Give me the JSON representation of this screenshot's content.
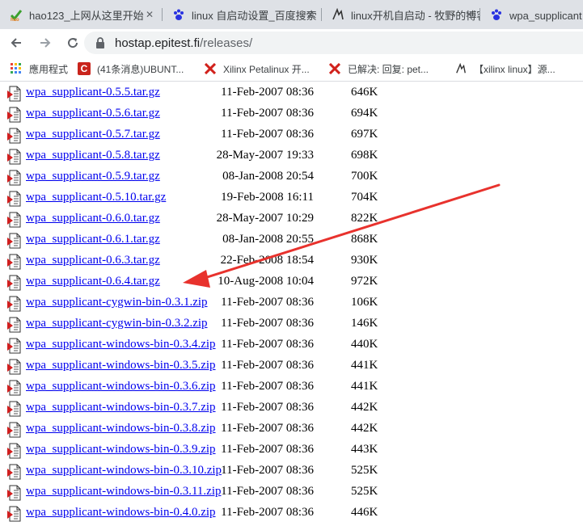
{
  "browser": {
    "tabs": [
      {
        "title": "hao123_上网从这里开始",
        "favicon": "hao123-icon",
        "active": false
      },
      {
        "title": "linux 自启动设置_百度搜索",
        "favicon": "baidu-paw-icon",
        "active": false
      },
      {
        "title": "linux开机自启动 - 牧野的博客",
        "favicon": "blog-icon",
        "active": false
      },
      {
        "title": "wpa_supplicant 选",
        "favicon": "baidu-paw-icon",
        "active": false
      }
    ],
    "address_bar": {
      "host": "hostap.epitest.fi",
      "path": "/releases/"
    },
    "bookmarks": [
      {
        "label": "應用程式",
        "icon": "apps-grid-icon"
      },
      {
        "label": "(41条消息)UBUNT...",
        "icon": "csdn-icon"
      },
      {
        "label": "Xilinx Petalinux 开...",
        "icon": "xilinx-icon"
      },
      {
        "label": "已解决: 回复: pet...",
        "icon": "xilinx-icon"
      },
      {
        "label": "【xilinx linux】源...",
        "icon": "blog-icon"
      }
    ]
  },
  "files": [
    {
      "name": "wpa_supplicant-0.5.5.tar.gz",
      "date": "11-Feb-2007 08:36",
      "size": "646K"
    },
    {
      "name": "wpa_supplicant-0.5.6.tar.gz",
      "date": "11-Feb-2007 08:36",
      "size": "694K"
    },
    {
      "name": "wpa_supplicant-0.5.7.tar.gz",
      "date": "11-Feb-2007 08:36",
      "size": "697K"
    },
    {
      "name": "wpa_supplicant-0.5.8.tar.gz",
      "date": "28-May-2007 19:33",
      "size": "698K"
    },
    {
      "name": "wpa_supplicant-0.5.9.tar.gz",
      "date": "08-Jan-2008 20:54",
      "size": "700K"
    },
    {
      "name": "wpa_supplicant-0.5.10.tar.gz",
      "date": "19-Feb-2008 16:11",
      "size": "704K"
    },
    {
      "name": "wpa_supplicant-0.6.0.tar.gz",
      "date": "28-May-2007 10:29",
      "size": "822K"
    },
    {
      "name": "wpa_supplicant-0.6.1.tar.gz",
      "date": "08-Jan-2008 20:55",
      "size": "868K"
    },
    {
      "name": "wpa_supplicant-0.6.3.tar.gz",
      "date": "22-Feb-2008 18:54",
      "size": "930K"
    },
    {
      "name": "wpa_supplicant-0.6.4.tar.gz",
      "date": "10-Aug-2008 10:04",
      "size": "972K"
    },
    {
      "name": "wpa_supplicant-cygwin-bin-0.3.1.zip",
      "date": "11-Feb-2007 08:36",
      "size": "106K"
    },
    {
      "name": "wpa_supplicant-cygwin-bin-0.3.2.zip",
      "date": "11-Feb-2007 08:36",
      "size": "146K"
    },
    {
      "name": "wpa_supplicant-windows-bin-0.3.4.zip",
      "date": "11-Feb-2007 08:36",
      "size": "440K"
    },
    {
      "name": "wpa_supplicant-windows-bin-0.3.5.zip",
      "date": "11-Feb-2007 08:36",
      "size": "441K"
    },
    {
      "name": "wpa_supplicant-windows-bin-0.3.6.zip",
      "date": "11-Feb-2007 08:36",
      "size": "441K"
    },
    {
      "name": "wpa_supplicant-windows-bin-0.3.7.zip",
      "date": "11-Feb-2007 08:36",
      "size": "442K"
    },
    {
      "name": "wpa_supplicant-windows-bin-0.3.8.zip",
      "date": "11-Feb-2007 08:36",
      "size": "442K"
    },
    {
      "name": "wpa_supplicant-windows-bin-0.3.9.zip",
      "date": "11-Feb-2007 08:36",
      "size": "443K"
    },
    {
      "name": "wpa_supplicant-windows-bin-0.3.10.zip",
      "date": "11-Feb-2007 08:36",
      "size": "525K"
    },
    {
      "name": "wpa_supplicant-windows-bin-0.3.11.zip",
      "date": "11-Feb-2007 08:36",
      "size": "525K"
    },
    {
      "name": "wpa_supplicant-windows-bin-0.4.0.zip",
      "date": "11-Feb-2007 08:36",
      "size": "446K"
    }
  ],
  "annotation": {
    "type": "red-arrow",
    "points_to_file": "wpa_supplicant-0.6.4.tar.gz",
    "color": "#e8322d"
  },
  "colors": {
    "link": "#0000ee",
    "tabstrip": "#dee1e6",
    "omnibox": "#f1f3f4"
  }
}
